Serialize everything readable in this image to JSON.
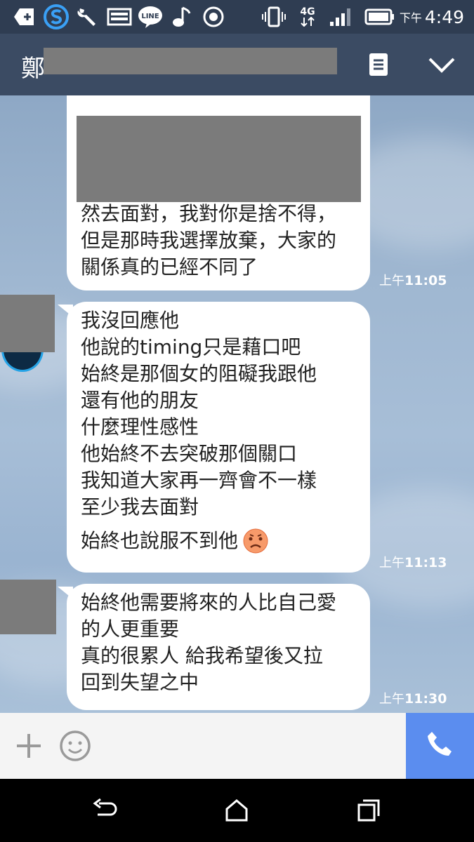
{
  "status_bar": {
    "time_prefix": "下午",
    "time": "4:49",
    "network": "4G",
    "line_label": "LINE",
    "icons": [
      "add-box-icon",
      "s-app-icon",
      "wrench-icon",
      "image-icon",
      "line-icon",
      "music-icon",
      "record-icon",
      "vibrate-icon",
      "network-4g-icon",
      "signal-icon",
      "battery-icon"
    ]
  },
  "header": {
    "title": "鄭"
  },
  "messages": [
    {
      "lines": [
        "然去面對，我對你是捨不得，",
        "但是那時我選擇放棄，大家的",
        "關係真的已經不同了"
      ],
      "time_prefix": "上午",
      "time": "11:05"
    },
    {
      "lines": [
        "我沒回應他",
        "他說的timing只是藉口吧",
        "始終是那個女的阻礙我跟他",
        "還有他的朋友",
        "什麼理性感性",
        "他始終不去突破那個關口",
        "我知道大家再一齊會不一樣",
        "至少我去面對"
      ],
      "last_line": "始終也說服不到他",
      "emoji": "sad-face-emoji",
      "time_prefix": "上午",
      "time": "11:13"
    },
    {
      "lines": [
        "始終他需要將來的人比自己愛",
        "的人更重要",
        "真的很累人  給我希望後又拉",
        "回到失望之中"
      ],
      "time_prefix": "上午",
      "time": "11:30"
    }
  ],
  "input_bar": {
    "icons": [
      "plus-icon",
      "emoji-icon",
      "phone-icon"
    ]
  },
  "nav_bar": {
    "icons": [
      "back-icon",
      "home-icon",
      "recents-icon"
    ]
  },
  "colors": {
    "status_bg": "#2f3d52",
    "header_bg": "#3b4b63",
    "chat_bg": "#9db5d0",
    "call_button": "#5b8def",
    "redaction": "#7b7b7b"
  }
}
